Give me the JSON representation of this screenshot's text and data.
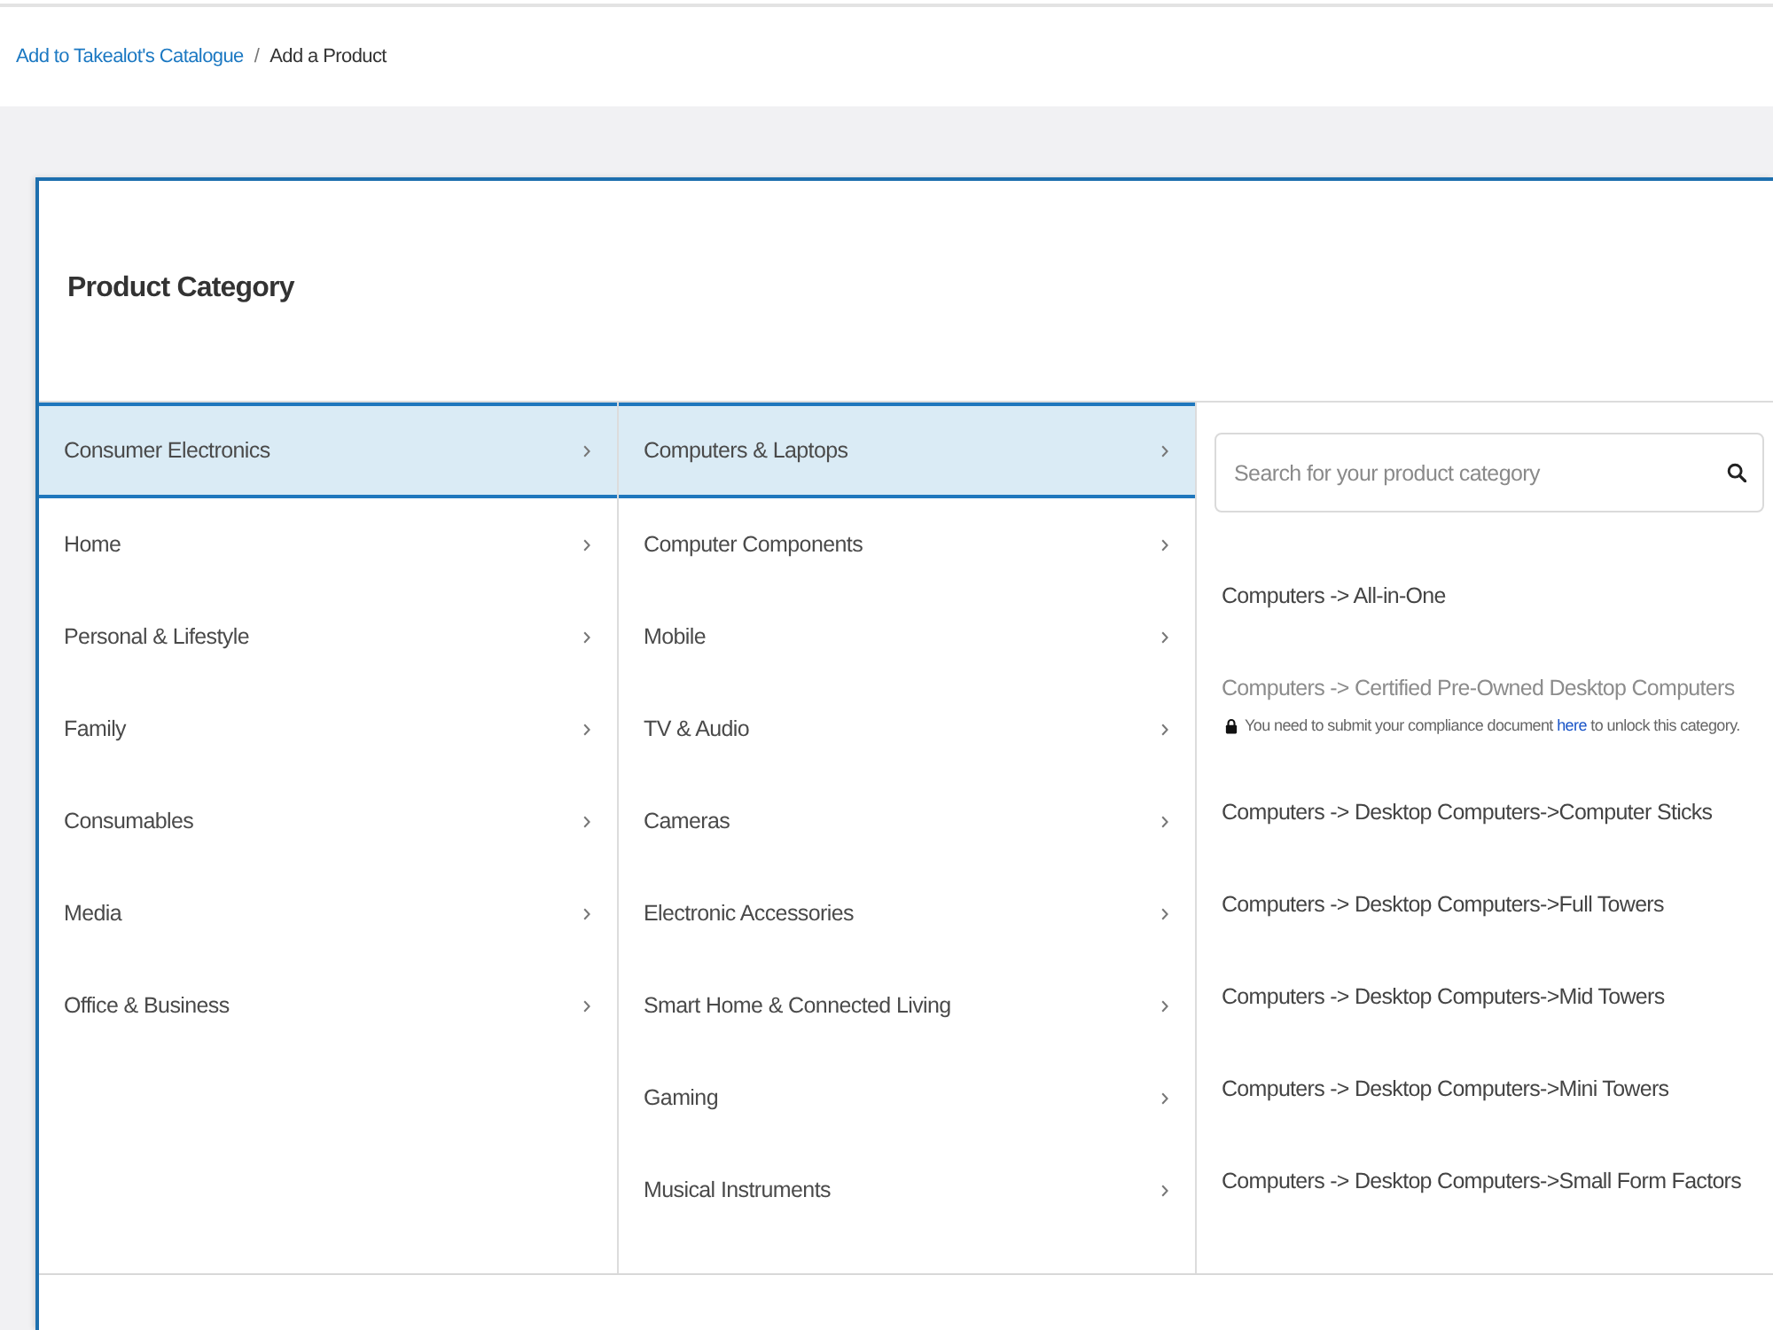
{
  "breadcrumb": {
    "separator": "/",
    "items": [
      {
        "label": "Add to Takealot's Catalogue",
        "kind": "link"
      },
      {
        "label": "Add a Product",
        "kind": "current"
      }
    ]
  },
  "panel": {
    "title": "Product Category",
    "columns": [
      {
        "items": [
          {
            "label": "Consumer Electronics",
            "selected": true
          },
          {
            "label": "Home",
            "selected": false
          },
          {
            "label": "Personal & Lifestyle",
            "selected": false
          },
          {
            "label": "Family",
            "selected": false
          },
          {
            "label": "Consumables",
            "selected": false
          },
          {
            "label": "Media",
            "selected": false
          },
          {
            "label": "Office & Business",
            "selected": false
          }
        ]
      },
      {
        "items": [
          {
            "label": "Computers & Laptops",
            "selected": true
          },
          {
            "label": "Computer Components",
            "selected": false
          },
          {
            "label": "Mobile",
            "selected": false
          },
          {
            "label": "TV & Audio",
            "selected": false
          },
          {
            "label": "Cameras",
            "selected": false
          },
          {
            "label": "Electronic Accessories",
            "selected": false
          },
          {
            "label": "Smart Home & Connected Living",
            "selected": false
          },
          {
            "label": "Gaming",
            "selected": false
          },
          {
            "label": "Musical Instruments",
            "selected": false
          }
        ]
      }
    ],
    "search": {
      "placeholder": "Search for your product category"
    },
    "results": [
      {
        "path": "Computers -> All-in-One",
        "locked": false
      },
      {
        "path": "Computers -> Certified Pre-Owned Desktop Computers",
        "locked": true,
        "note": {
          "before": "You need to submit your compliance document",
          "link": "here",
          "after": "to unlock this category."
        }
      },
      {
        "path": "Computers -> Desktop Computers->Computer Sticks",
        "locked": false
      },
      {
        "path": "Computers -> Desktop Computers->Full Towers",
        "locked": false
      },
      {
        "path": "Computers -> Desktop Computers->Mid Towers",
        "locked": false
      },
      {
        "path": "Computers -> Desktop Computers->Mini Towers",
        "locked": false
      },
      {
        "path": "Computers -> Desktop Computers->Small Form Factors",
        "locked": false
      }
    ]
  }
}
